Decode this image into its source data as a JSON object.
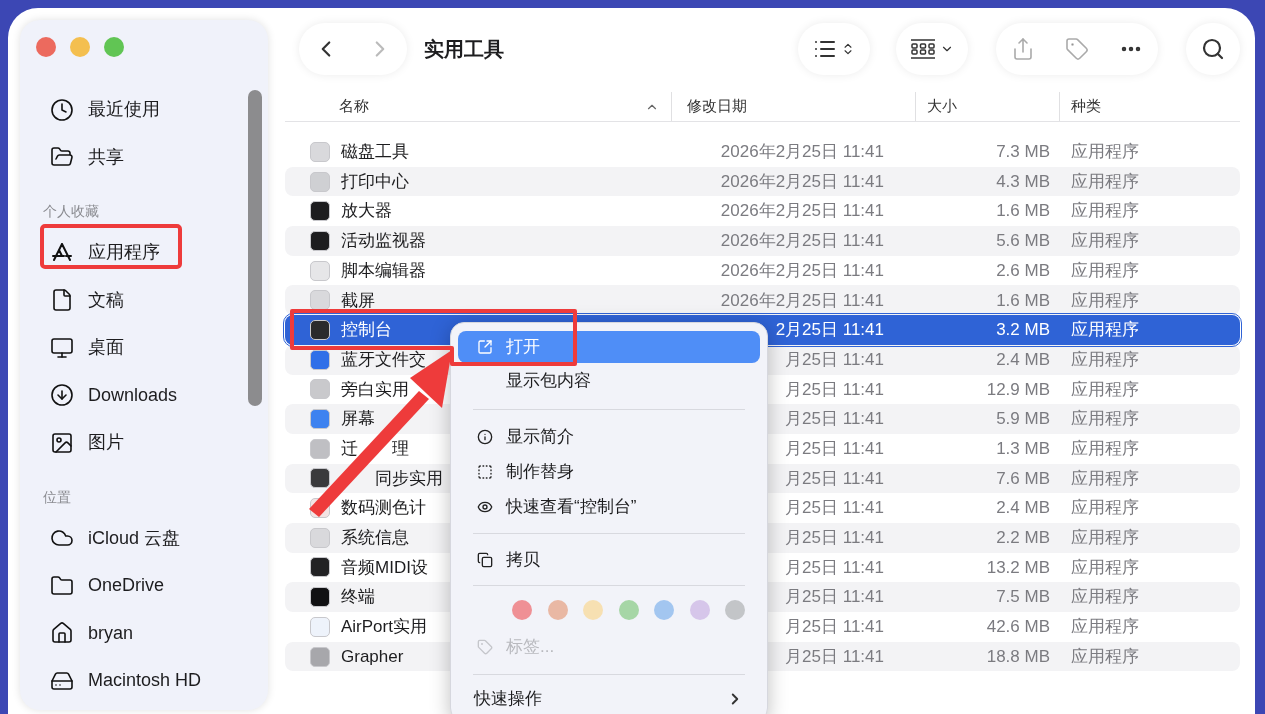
{
  "window": {
    "title": "实用工具"
  },
  "sidebar": {
    "sections": [
      {
        "items": [
          {
            "label": "最近使用",
            "annotated": false
          },
          {
            "label": "共享",
            "annotated": false
          }
        ]
      },
      {
        "header": "个人收藏",
        "items": [
          {
            "label": "应用程序",
            "annotated": true
          },
          {
            "label": "文稿",
            "annotated": false
          },
          {
            "label": "桌面",
            "annotated": false
          },
          {
            "label": "Downloads",
            "annotated": false
          },
          {
            "label": "图片",
            "annotated": false
          }
        ]
      },
      {
        "header": "位置",
        "items": [
          {
            "label": "iCloud 云盘",
            "annotated": false
          },
          {
            "label": "OneDrive",
            "annotated": false
          },
          {
            "label": "bryan",
            "annotated": false
          },
          {
            "label": "Macintosh HD",
            "annotated": false
          }
        ]
      }
    ]
  },
  "table": {
    "columns": [
      "名称",
      "修改日期",
      "大小",
      "种类"
    ],
    "rows": [
      {
        "name": "磁盘工具",
        "modified": "2026年2月25日 11:41",
        "size": "7.3 MB",
        "kind": "应用程序",
        "selected": false
      },
      {
        "name": "打印中心",
        "modified": "2026年2月25日 11:41",
        "size": "4.3 MB",
        "kind": "应用程序",
        "selected": false
      },
      {
        "name": "放大器",
        "modified": "2026年2月25日 11:41",
        "size": "1.6 MB",
        "kind": "应用程序",
        "selected": false
      },
      {
        "name": "活动监视器",
        "modified": "2026年2月25日 11:41",
        "size": "5.6 MB",
        "kind": "应用程序",
        "selected": false
      },
      {
        "name": "脚本编辑器",
        "modified": "2026年2月25日 11:41",
        "size": "2.6 MB",
        "kind": "应用程序",
        "selected": false
      },
      {
        "name": "截屏",
        "modified": "2026年2月25日 11:41",
        "size": "1.6 MB",
        "kind": "应用程序",
        "selected": false
      },
      {
        "name": "控制台",
        "modified": "2月25日 11:41",
        "size": "3.2 MB",
        "kind": "应用程序",
        "selected": true
      },
      {
        "name": "蓝牙文件交",
        "modified": "月25日 11:41",
        "size": "2.4 MB",
        "kind": "应用程序",
        "selected": false
      },
      {
        "name_parts": [
          {
            "text": "旁白实用",
            "covered_before": false
          }
        ],
        "modified": "月25日 11:41",
        "size": "12.9 MB",
        "kind": "应用程序",
        "selected": false
      },
      {
        "name_parts": [
          {
            "text": "屏幕",
            "covered_before": false
          }
        ],
        "modified": "月25日 11:41",
        "size": "5.9 MB",
        "kind": "应用程序",
        "selected": false
      },
      {
        "name_parts": [
          {
            "text": "迁",
            "covered_before": false
          },
          {
            "text": "理",
            "covered_before": true
          }
        ],
        "modified": "月25日 11:41",
        "size": "1.3 MB",
        "kind": "应用程序",
        "selected": false
      },
      {
        "name_parts": [
          {
            "text": "同步实用",
            "covered_before": true
          }
        ],
        "modified": "月25日 11:41",
        "size": "7.6 MB",
        "kind": "应用程序",
        "selected": false
      },
      {
        "name": "数码测色计",
        "modified": "月25日 11:41",
        "size": "2.4 MB",
        "kind": "应用程序",
        "selected": false
      },
      {
        "name": "系统信息",
        "modified": "月25日 11:41",
        "size": "2.2 MB",
        "kind": "应用程序",
        "selected": false
      },
      {
        "name": "音频MIDI设",
        "modified": "月25日 11:41",
        "size": "13.2 MB",
        "kind": "应用程序",
        "selected": false
      },
      {
        "name": "终端",
        "modified": "月25日 11:41",
        "size": "7.5 MB",
        "kind": "应用程序",
        "selected": false
      },
      {
        "name": "AirPort实用",
        "modified": "月25日 11:41",
        "size": "42.6 MB",
        "kind": "应用程序",
        "selected": false
      },
      {
        "name": "Grapher",
        "modified": "月25日 11:41",
        "size": "18.8 MB",
        "kind": "应用程序",
        "selected": false
      }
    ]
  },
  "context_menu": {
    "items": [
      {
        "kind": "item",
        "label": "打开",
        "selected": true,
        "disabled": false
      },
      {
        "kind": "item",
        "label": "显示包内容",
        "selected": false,
        "disabled": false
      },
      {
        "kind": "separator"
      },
      {
        "kind": "item",
        "label": "显示简介",
        "selected": false,
        "disabled": false
      },
      {
        "kind": "item",
        "label": "制作替身",
        "selected": false,
        "disabled": false
      },
      {
        "kind": "item",
        "label": "快速查看“控制台”",
        "selected": false,
        "disabled": false
      },
      {
        "kind": "separator"
      },
      {
        "kind": "item",
        "label": "拷贝",
        "selected": false,
        "disabled": false
      },
      {
        "kind": "separator"
      },
      {
        "kind": "colors",
        "colors": [
          {
            "color": "#ef9095"
          },
          {
            "color": "#e9b8a4"
          },
          {
            "color": "#f7e0b2"
          },
          {
            "color": "#a6d6a6"
          },
          {
            "color": "#a3c6f0"
          },
          {
            "color": "#d6c6ea"
          },
          {
            "color": "#c3c5c8"
          }
        ]
      },
      {
        "kind": "item",
        "label": "标签...",
        "selected": false,
        "disabled": true
      },
      {
        "kind": "separator"
      },
      {
        "kind": "submenu",
        "label": "快速操作"
      }
    ]
  }
}
